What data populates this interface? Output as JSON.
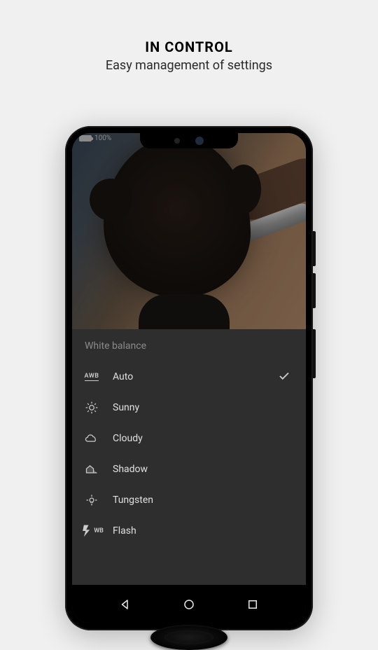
{
  "header": {
    "title": "IN CONTROL",
    "subtitle": "Easy management of settings"
  },
  "status": {
    "battery_label": "100%"
  },
  "panel": {
    "title": "White balance",
    "items": [
      {
        "icon": "awb",
        "label": "Auto",
        "selected": true
      },
      {
        "icon": "sunny",
        "label": "Sunny",
        "selected": false
      },
      {
        "icon": "cloudy",
        "label": "Cloudy",
        "selected": false
      },
      {
        "icon": "shadow",
        "label": "Shadow",
        "selected": false
      },
      {
        "icon": "tungsten",
        "label": "Tungsten",
        "selected": false
      },
      {
        "icon": "flash",
        "label": "Flash",
        "selected": false
      }
    ],
    "awb_text": "AWB",
    "flash_text": "WB"
  }
}
